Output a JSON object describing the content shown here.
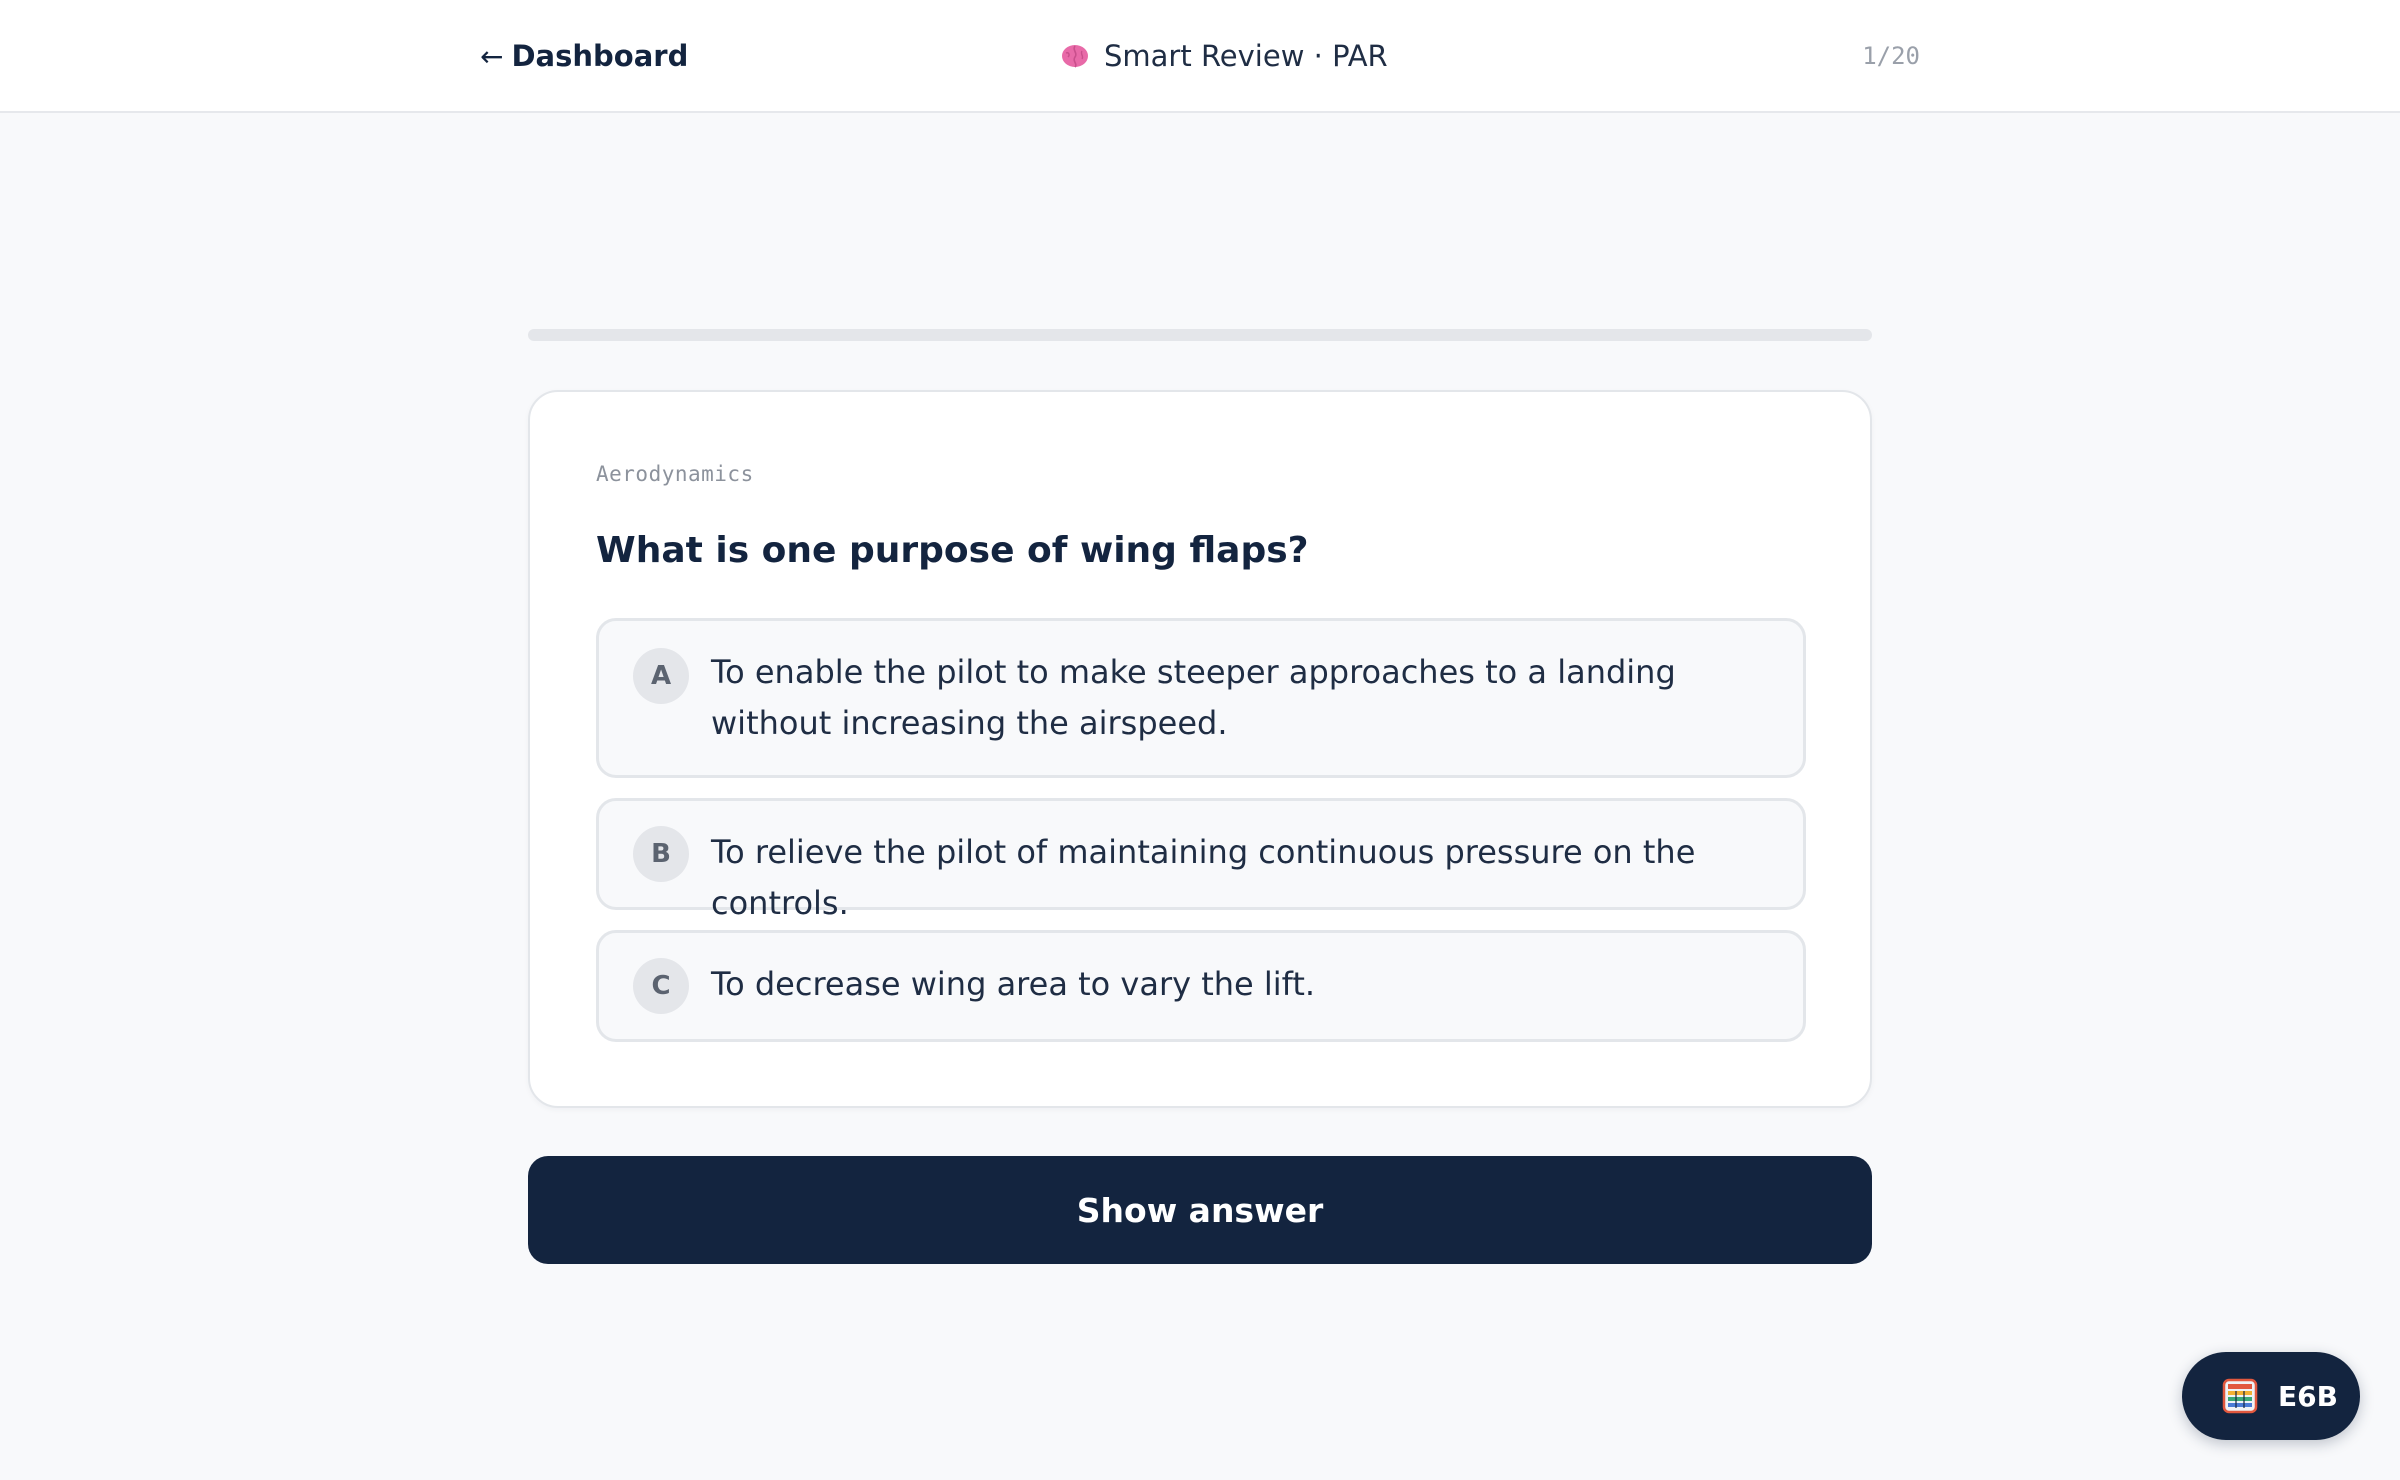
{
  "header": {
    "back_arrow": "←",
    "back_label": "Dashboard",
    "title": "Smart Review · PAR",
    "title_icon": "brain-icon",
    "counter": "1/20"
  },
  "progress": {
    "fraction": 0.0
  },
  "question": {
    "category": "Aerodynamics",
    "text": "What is one purpose of wing flaps?",
    "options": [
      {
        "letter": "A",
        "text": "To enable the pilot to make steeper approaches to a landing without increasing the airspeed."
      },
      {
        "letter": "B",
        "text": "To relieve the pilot of maintaining continuous pressure on the controls."
      },
      {
        "letter": "C",
        "text": "To decrease wing area to vary the lift."
      }
    ]
  },
  "actions": {
    "show_answer": "Show answer"
  },
  "fab": {
    "label": "E6B",
    "icon": "calculator-icon"
  },
  "colors": {
    "navy": "#13243f",
    "background": "#f8f9fb",
    "border": "#e3e6ea",
    "brain": "#e86aa8"
  }
}
